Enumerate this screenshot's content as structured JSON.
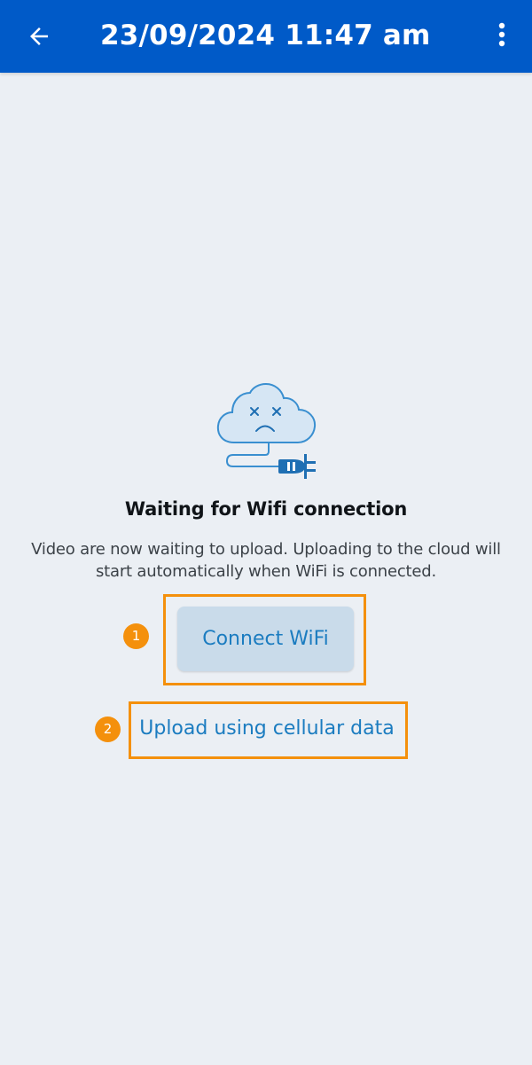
{
  "appbar": {
    "title": "23/09/2024 11:47 am",
    "back_icon": "arrow-left-icon",
    "menu_icon": "more-vertical-icon",
    "background_color": "#005ac8"
  },
  "status": {
    "illustration_icon": "disconnected-cloud-icon",
    "heading": "Waiting for Wifi connection",
    "description": "Video are now waiting to upload. Uploading to the cloud will start automatically when WiFi is connected."
  },
  "actions": {
    "connect_wifi_label": "Connect WiFi",
    "cellular_label": "Upload using cellular data",
    "link_color": "#1b7cc0"
  },
  "annotations": {
    "marker_1": "1",
    "marker_2": "2",
    "highlight_color": "#f4900c"
  }
}
